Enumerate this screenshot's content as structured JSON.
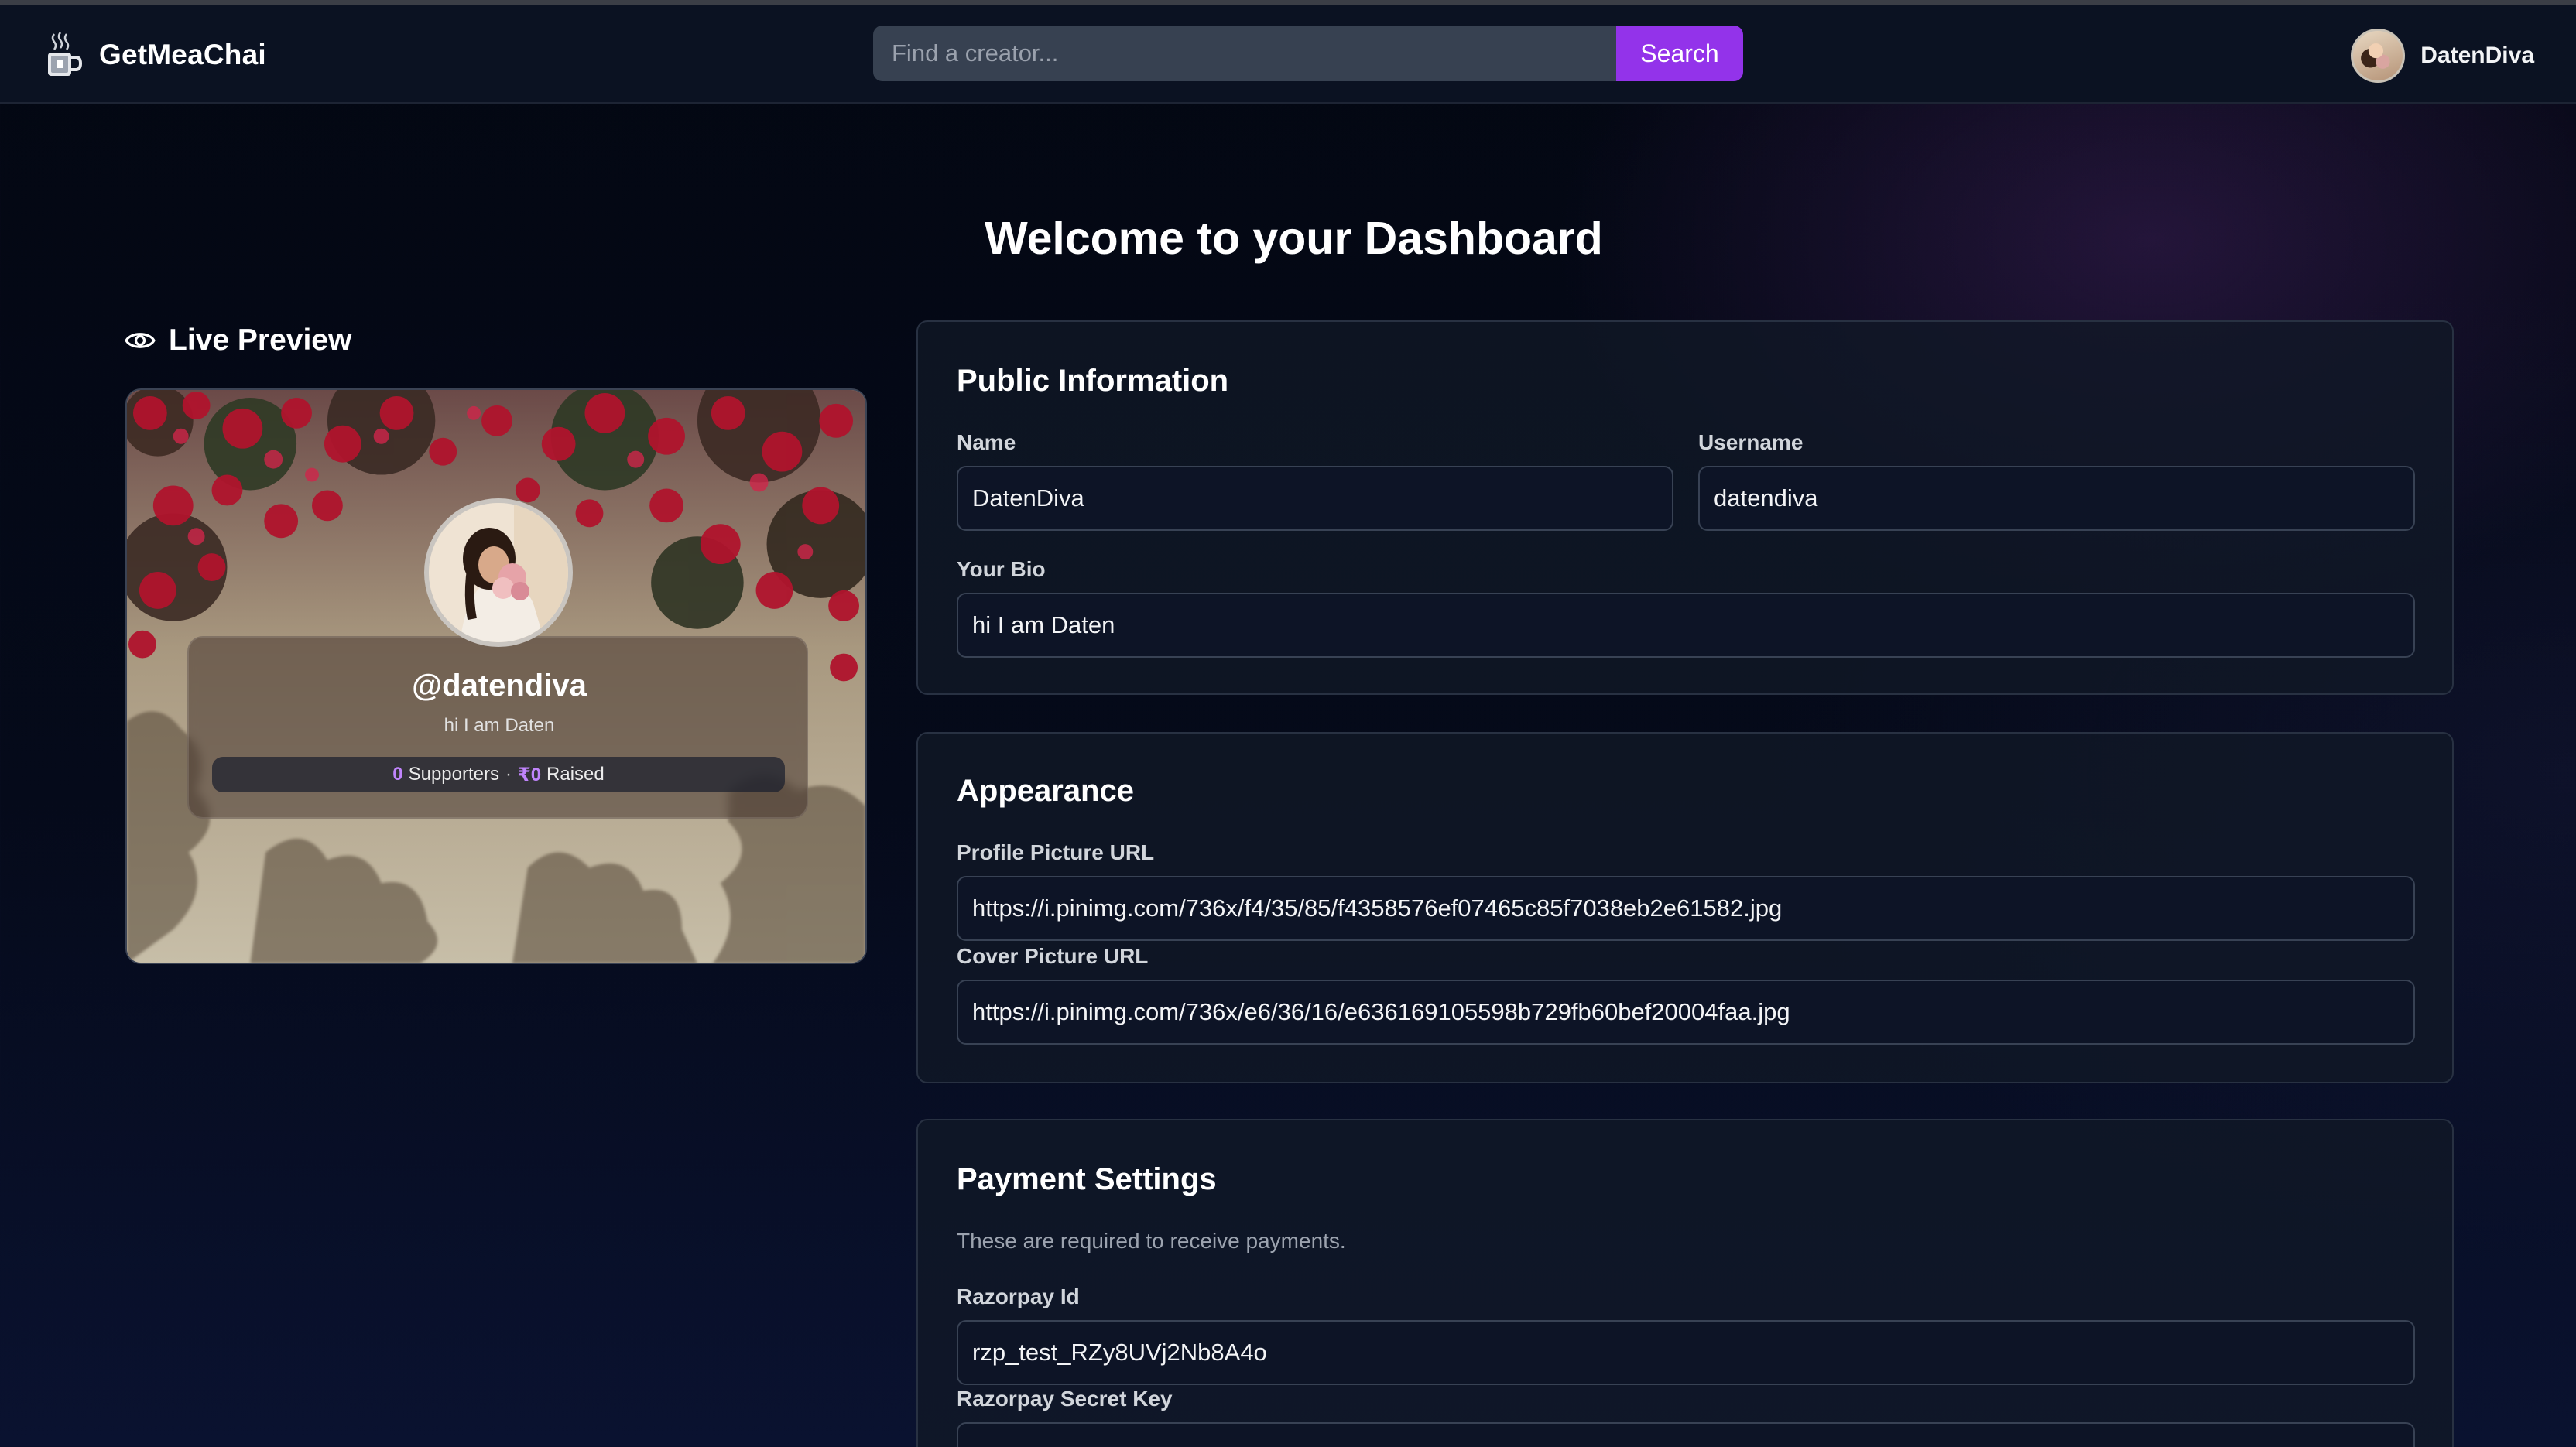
{
  "brand": {
    "name": "GetMeaChai",
    "icon": "chai-cup-icon"
  },
  "search": {
    "placeholder": "Find a creator...",
    "button_label": "Search"
  },
  "user": {
    "display_name": "DatenDiva"
  },
  "page": {
    "title": "Welcome to your Dashboard"
  },
  "preview": {
    "heading": "Live Preview",
    "handle": "@datendiva",
    "bio": "hi I am Daten",
    "supporters_count": "0",
    "supporters_label": "Supporters",
    "separator": "·",
    "raised_amount": "₹0",
    "raised_label": "Raised"
  },
  "public_info": {
    "title": "Public Information",
    "name_label": "Name",
    "name_value": "DatenDiva",
    "username_label": "Username",
    "username_value": "datendiva",
    "bio_label": "Your Bio",
    "bio_value": "hi I am Daten"
  },
  "appearance": {
    "title": "Appearance",
    "profile_pic_label": "Profile Picture URL",
    "profile_pic_value": "https://i.pinimg.com/736x/f4/35/85/f4358576ef07465c85f7038eb2e61582.jpg",
    "cover_pic_label": "Cover Picture URL",
    "cover_pic_value": "https://i.pinimg.com/736x/e6/36/16/e636169105598b729fb60bef20004faa.jpg"
  },
  "payment": {
    "title": "Payment Settings",
    "note": "These are required to receive payments.",
    "razorpay_id_label": "Razorpay Id",
    "razorpay_id_value": "rzp_test_RZy8UVj2Nb8A4o",
    "razorpay_secret_label": "Razorpay Secret Key"
  },
  "colors": {
    "accent": "#9333ea",
    "stat_highlight": "#c084fc",
    "background": "#030712",
    "card": "#111827"
  }
}
